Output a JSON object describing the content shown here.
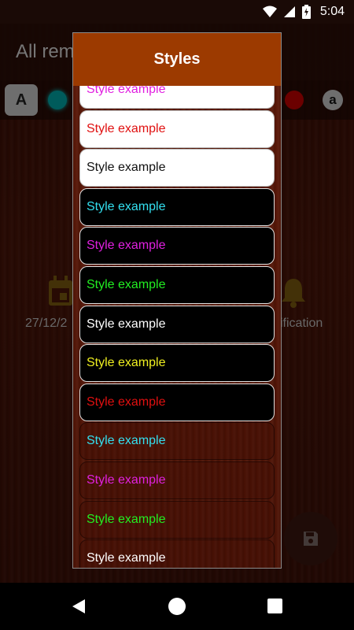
{
  "status_bar": {
    "time": "5:04"
  },
  "app": {
    "title": "All rem",
    "tool_a_label": "A",
    "tool_a_round_label": "a",
    "date_text": "27/12/2",
    "notification_text": "ification"
  },
  "dialog": {
    "title": "Styles",
    "items": [
      {
        "label": "Style example",
        "bg": "white",
        "color": "#e01ee0"
      },
      {
        "label": "Style example",
        "bg": "white",
        "color": "#e01010"
      },
      {
        "label": "Style example",
        "bg": "white",
        "color": "#111111"
      },
      {
        "label": "Style example",
        "bg": "black",
        "color": "#33e0f0"
      },
      {
        "label": "Style example",
        "bg": "black",
        "color": "#e020e0"
      },
      {
        "label": "Style example",
        "bg": "black",
        "color": "#22ee22"
      },
      {
        "label": "Style example",
        "bg": "black",
        "color": "#ffffff"
      },
      {
        "label": "Style example",
        "bg": "black",
        "color": "#f0f020"
      },
      {
        "label": "Style example",
        "bg": "black",
        "color": "#e01010"
      },
      {
        "label": "Style example",
        "bg": "wood",
        "color": "#33e0f0"
      },
      {
        "label": "Style example",
        "bg": "wood",
        "color": "#e020e0"
      },
      {
        "label": "Style example",
        "bg": "wood",
        "color": "#22ee22"
      },
      {
        "label": "Style example",
        "bg": "wood",
        "color": "#ffffff"
      }
    ]
  }
}
